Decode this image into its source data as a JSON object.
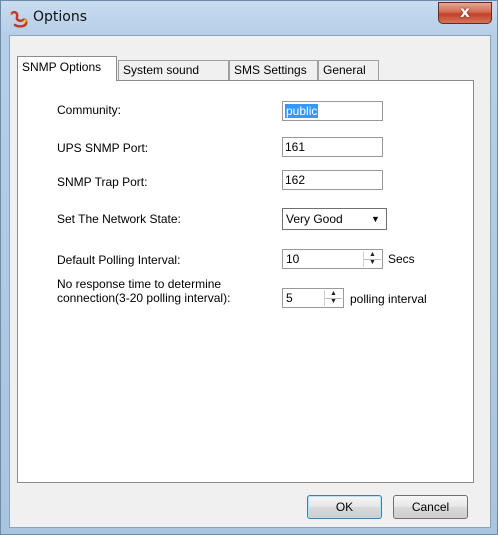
{
  "window": {
    "title": "Options",
    "close_glyph": "x",
    "app_icon": "snake-app-icon"
  },
  "tabs": [
    {
      "label": "SNMP Options",
      "active": true
    },
    {
      "label": "System sound",
      "active": false
    },
    {
      "label": "SMS Settings",
      "active": false
    },
    {
      "label": "General",
      "active": false
    }
  ],
  "form": {
    "community": {
      "label": "Community:",
      "value": "public"
    },
    "ups_port": {
      "label": "UPS SNMP Port:",
      "value": "161"
    },
    "trap_port": {
      "label": "SNMP Trap Port:",
      "value": "162"
    },
    "network_state": {
      "label": "Set The Network State:",
      "value": "Very Good"
    },
    "polling": {
      "label": "Default Polling Interval:",
      "value": "10",
      "unit": "Secs"
    },
    "no_response": {
      "label_line1": "No response time to determine",
      "label_line2": "connection(3-20 polling interval):",
      "value": "5",
      "unit": "polling interval"
    }
  },
  "buttons": {
    "ok": "OK",
    "cancel": "Cancel"
  },
  "colors": {
    "selection": "#3399ff",
    "close_button": "#c2412a"
  }
}
